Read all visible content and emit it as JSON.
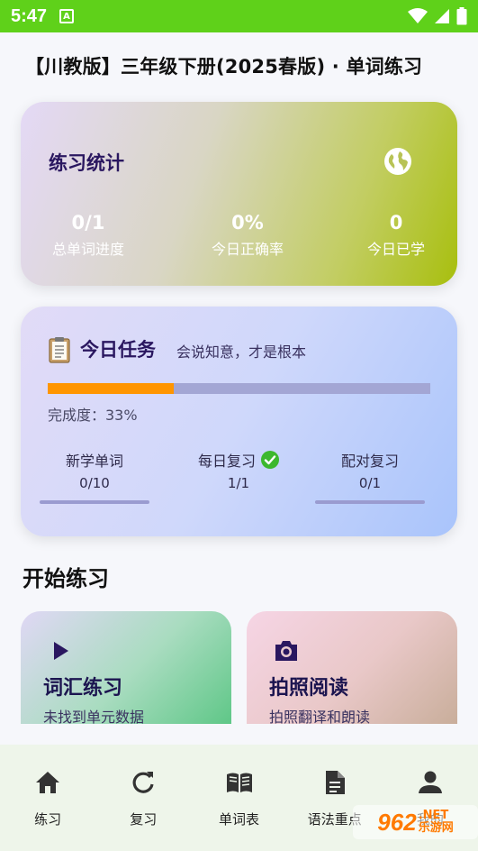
{
  "status_bar": {
    "time": "5:47",
    "notification_letter": "A"
  },
  "page": {
    "title": "【川教版】三年级下册(2025春版) · 单词练习"
  },
  "stats": {
    "title": "练习统计",
    "icon": "globe-icon",
    "items": [
      {
        "value": "0/1",
        "label": "总单词进度"
      },
      {
        "value": "0%",
        "label": "今日正确率"
      },
      {
        "value": "0",
        "label": "今日已学"
      }
    ]
  },
  "task": {
    "icon": "clipboard-icon",
    "title": "今日任务",
    "subtitle": "会说知意，才是根本",
    "progress": 0.33,
    "completion_text": "完成度：33%",
    "progress_color": "#ff9500",
    "columns": [
      {
        "label": "新学单词",
        "value": "0/10",
        "done": false
      },
      {
        "label": "每日复习",
        "value": "1/1",
        "done": true
      },
      {
        "label": "配对复习",
        "value": "0/1",
        "done": false
      }
    ]
  },
  "section": {
    "title": "开始练习"
  },
  "practice_cards": [
    {
      "icon": "play-icon",
      "title": "词汇练习",
      "subtitle": "未找到单元数据"
    },
    {
      "icon": "camera-icon",
      "title": "拍照阅读",
      "subtitle": "拍照翻译和朗读"
    }
  ],
  "nav": {
    "items": [
      {
        "icon": "home-icon",
        "label": "练习"
      },
      {
        "icon": "refresh-icon",
        "label": "复习"
      },
      {
        "icon": "book-icon",
        "label": "单词表"
      },
      {
        "icon": "document-icon",
        "label": "语法重点"
      },
      {
        "icon": "person-icon",
        "label": "我的"
      }
    ]
  },
  "watermark": {
    "big": "962",
    "small_top": ".NET",
    "small_bottom": "乐游网"
  },
  "colors": {
    "status_bar": "#5fd11a",
    "accent_orange": "#ff9500",
    "check_green": "#3cb82e"
  }
}
